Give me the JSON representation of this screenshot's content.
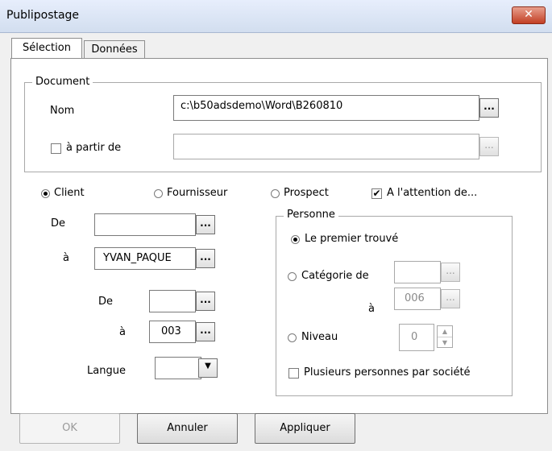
{
  "window": {
    "title": "Publipostage",
    "close_glyph": "✕"
  },
  "tabs": [
    {
      "label": "Sélection",
      "active": true
    },
    {
      "label": "Données",
      "active": false
    }
  ],
  "document": {
    "legend": "Document",
    "nom_label": "Nom",
    "nom_value": "c:\\b50adsdemo\\Word\\B260810",
    "a_partir_de_label": "à partir de",
    "a_partir_de_checked": false,
    "a_partir_de_value": ""
  },
  "type_radios": [
    {
      "label": "Client",
      "selected": true
    },
    {
      "label": "Fournisseur",
      "selected": false
    },
    {
      "label": "Prospect",
      "selected": false
    }
  ],
  "attention": {
    "label": "A l'attention de...",
    "checked": true
  },
  "range1": {
    "de_label": "De",
    "de_value": "",
    "a_label": "à",
    "a_value": "YVAN_PAQUE"
  },
  "range2": {
    "de_label": "De",
    "de_value": "",
    "a_label": "à",
    "a_value": "003"
  },
  "langue": {
    "label": "Langue",
    "value": ""
  },
  "personne": {
    "legend": "Personne",
    "premier_label": "Le premier trouvé",
    "premier_selected": true,
    "categorie_label": "Catégorie de",
    "categorie_selected": false,
    "categorie_de_value": "",
    "categorie_a_label": "à",
    "categorie_a_value": "006",
    "niveau_label": "Niveau",
    "niveau_selected": false,
    "niveau_value": "0",
    "plusieurs_label": "Plusieurs personnes par société",
    "plusieurs_checked": false
  },
  "ellipsis": "...",
  "buttons": {
    "ok": "OK",
    "annuler": "Annuler",
    "appliquer": "Appliquer"
  }
}
